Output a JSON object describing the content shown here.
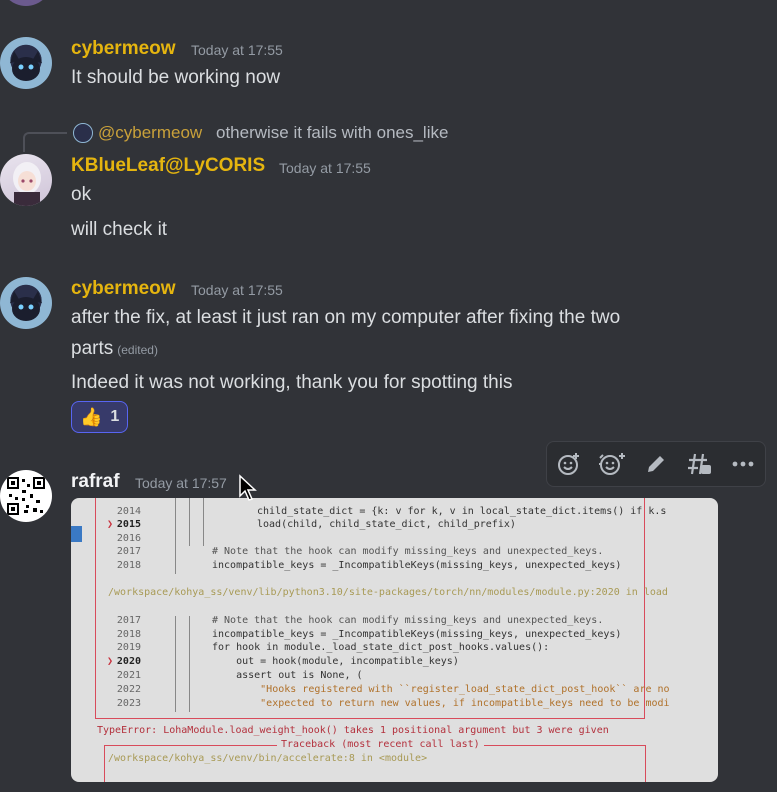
{
  "messages": [
    {
      "author": "cybermeow",
      "time": "Today at 17:55",
      "lines": [
        "It should be working now"
      ]
    },
    {
      "reply": {
        "mention": "@cybermeow",
        "text": "otherwise it fails with ones_like"
      },
      "author": "KBlueLeaf@LyCORIS",
      "time": "Today at 17:55",
      "lines": [
        "ok",
        "will check it"
      ]
    },
    {
      "author": "cybermeow",
      "time": "Today at 17:55",
      "lines": [
        "after the fix, at least it just ran on my computer after fixing the two",
        "parts",
        "Indeed it was not working, thank you for spotting this"
      ],
      "edited": "(edited)",
      "reaction": {
        "emoji": "👍",
        "count": "1"
      }
    },
    {
      "author": "rafraf",
      "time": "Today at 17:57"
    }
  ],
  "toolbar": {
    "icons": [
      "add-reaction-icon",
      "super-reaction-icon",
      "edit-icon",
      "create-thread-icon",
      "more-icon"
    ]
  },
  "code_image": {
    "lines": [
      {
        "ln": "2014",
        "text": "child_state_dict = {k: v for k, v in local_state_dict.items() if k.s"
      },
      {
        "ln": "2015",
        "text": "load(child, child_state_dict, child_prefix)",
        "marker": "❯"
      },
      {
        "ln": "2016",
        "text": ""
      },
      {
        "ln": "2017",
        "text": "# Note that the hook can modify missing_keys and unexpected_keys."
      },
      {
        "ln": "2018",
        "text": "incompatible_keys = _IncompatibleKeys(missing_keys, unexpected_keys)"
      },
      {
        "path": "/workspace/kohya_ss/venv/lib/python3.10/site-packages/torch/nn/modules/module.py:2020 in load"
      },
      {
        "ln": "2017",
        "text": "# Note that the hook can modify missing_keys and unexpected_keys."
      },
      {
        "ln": "2018",
        "text": "incompatible_keys = _IncompatibleKeys(missing_keys, unexpected_keys)"
      },
      {
        "ln": "2019",
        "text": "for hook in module._load_state_dict_post_hooks.values():"
      },
      {
        "ln": "2020",
        "text": "    out = hook(module, incompatible_keys)",
        "marker": "❯"
      },
      {
        "ln": "2021",
        "text": "    assert out is None, ("
      },
      {
        "ln": "2022",
        "text": "        \"Hooks registered with ``register_load_state_dict_post_hook`` are no"
      },
      {
        "ln": "2023",
        "text": "        \"expected to return new values, if incompatible_keys need to be modi"
      }
    ],
    "error": "TypeError: LohaModule.load_weight_hook() takes 1 positional argument but 3 were given",
    "traceback_title": "Traceback (most recent call last)",
    "traceback_path": "/workspace/kohya_ss/venv/bin/accelerate:8 in <module>"
  },
  "colors": {
    "background": "#313338",
    "gold_name": "#e5b50f",
    "reaction_bg": "#373a6a",
    "reaction_border": "#5865f2"
  }
}
